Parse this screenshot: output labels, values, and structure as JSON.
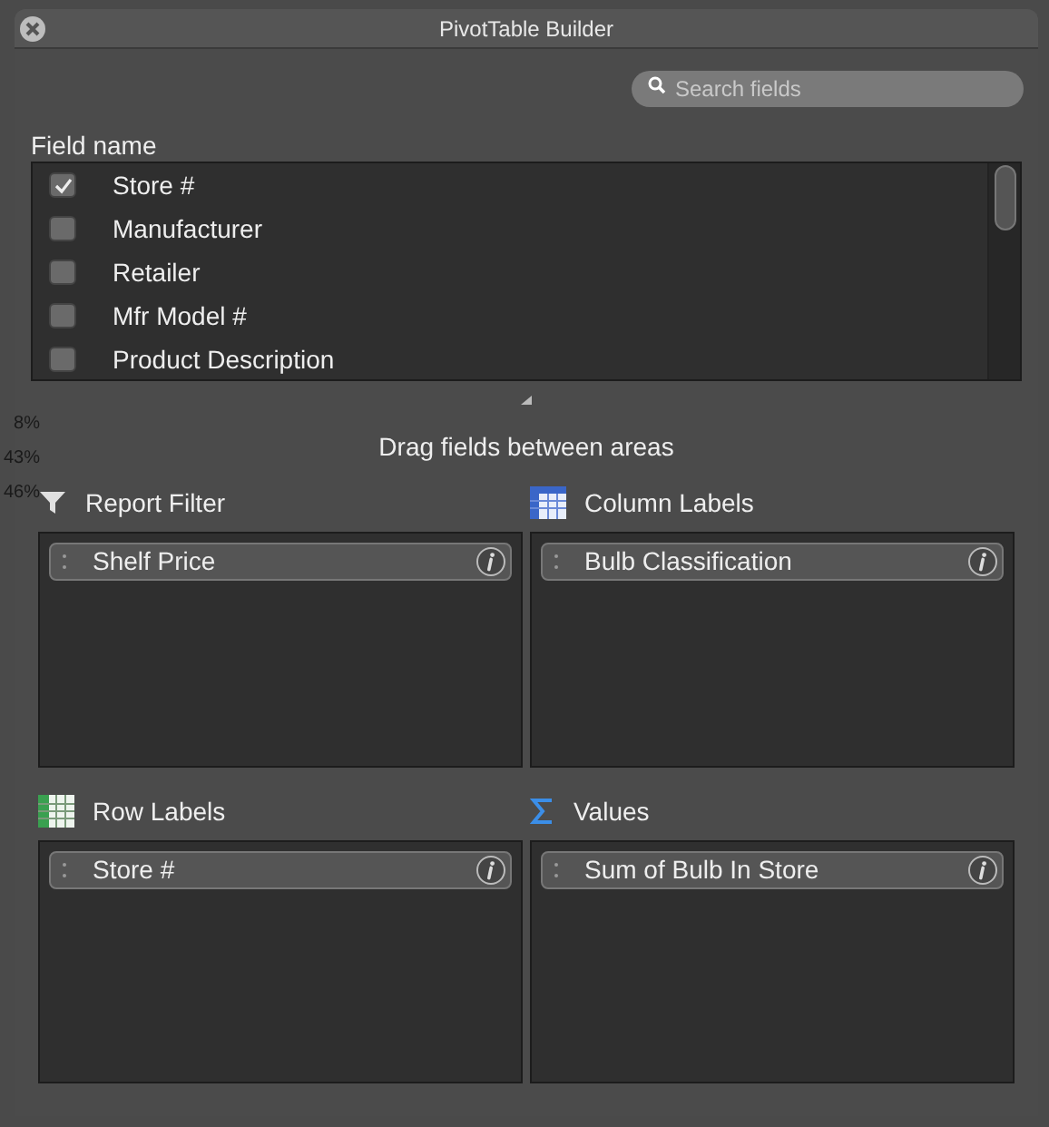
{
  "window": {
    "title": "PivotTable Builder"
  },
  "search": {
    "placeholder": "Search fields"
  },
  "field_list": {
    "heading": "Field name",
    "fields": [
      {
        "label": "Store #",
        "checked": true
      },
      {
        "label": "Manufacturer",
        "checked": false
      },
      {
        "label": "Retailer",
        "checked": false
      },
      {
        "label": "Mfr Model #",
        "checked": false
      },
      {
        "label": "Product Description",
        "checked": false
      }
    ]
  },
  "background_cells": [
    "8%",
    "43%",
    "46%"
  ],
  "hint": "Drag fields between areas",
  "areas": [
    {
      "kind": "filter",
      "title": "Report Filter",
      "items": [
        "Shelf Price"
      ]
    },
    {
      "kind": "columns",
      "title": "Column Labels",
      "items": [
        "Bulb Classification"
      ]
    },
    {
      "kind": "rows",
      "title": "Row Labels",
      "items": [
        "Store #"
      ]
    },
    {
      "kind": "values",
      "title": "Values",
      "items": [
        "Sum of Bulb In Store"
      ]
    }
  ]
}
